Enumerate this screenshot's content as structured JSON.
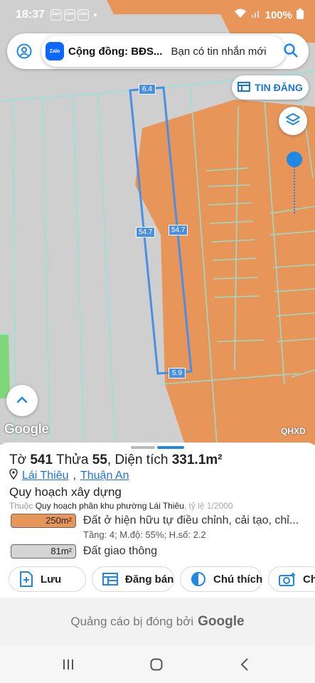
{
  "status_bar": {
    "time": "18:37",
    "app_badges": [
      "Zalo",
      "Zalo",
      "Zalo"
    ],
    "battery": "100%"
  },
  "search_bar": {
    "notification": {
      "app": "Zalo",
      "title": "Cộng đồng: BĐS...",
      "message": "Bạn có tin nhắn mới"
    }
  },
  "tin_dang_label": "TIN ĐĂNG",
  "map": {
    "parcel_edges": {
      "top": "6.4",
      "left": "54.7",
      "right": "54.7",
      "bottom": "5.9"
    },
    "watermark": "Google",
    "layer_code": "QHXD"
  },
  "parcel": {
    "to_label": "Tờ",
    "to_value": "541",
    "thua_label": "Thửa",
    "thua_value": "55",
    "area_label": "Diện tích",
    "area_value": "331.1m²",
    "ward": "Lái Thiêu",
    "district": "Thuận An"
  },
  "planning": {
    "title": "Quy hoạch xây dựng",
    "prefix": "Thuộc",
    "plan_name": "Quy hoạch phân khu phường Lái Thiêu",
    "scale": "tỷ lệ 1/2000",
    "uses": [
      {
        "area": "250m²",
        "label": "Đất ở hiện hữu tự điều chỉnh, cải tạo, chỉ...",
        "detail": "Tầng: 4; M.độ: 55%; H.số: 2.2",
        "color": "#e8955a"
      },
      {
        "area": "81m²",
        "label": "Đất giao thông",
        "color": "#d4d4d4"
      }
    ]
  },
  "actions": {
    "save": "Lưu",
    "sell": "Đăng bán",
    "legend": "Chú thích",
    "photo": "Chụ"
  },
  "ad": {
    "text": "Quảng cáo bị đóng bởi",
    "brand": "Google"
  },
  "colors": {
    "accent": "#1e88e5",
    "zone_orange": "#e8955a",
    "parcel_line": "#4a90e2",
    "cadastral_line": "#8de8d8"
  }
}
